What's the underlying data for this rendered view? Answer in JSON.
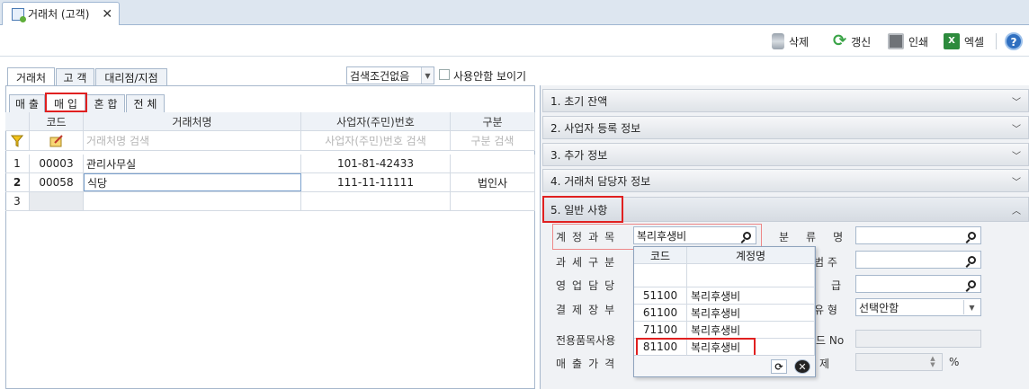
{
  "doc_tab": {
    "title": "거래처 (고객)",
    "close": "✕"
  },
  "toolbar": {
    "delete_label": "삭제",
    "refresh_label": "갱신",
    "print_label": "인쇄",
    "excel_label": "엑셀",
    "help_label": "?"
  },
  "main_tabs": [
    "거래처",
    "고 객",
    "대리점/지점"
  ],
  "search_condition": {
    "value": "검색조건없음",
    "show_unused_label": "사용안함 보이기"
  },
  "sub_tabs": [
    "매 출",
    "매 입",
    "혼 합",
    "전 체"
  ],
  "grid": {
    "columns": [
      "코드",
      "거래처명",
      "사업자(주민)번호",
      "구분"
    ],
    "filter_placeholders": [
      "거래처명 검색",
      "사업자(주민)번호 검색",
      "구분 검색"
    ],
    "rows": [
      {
        "num": "1",
        "code": "00003",
        "name": "관리사무실",
        "bizno": "101-81-42433",
        "type": ""
      },
      {
        "num": "2",
        "code": "00058",
        "name": "식당",
        "bizno": "111-11-11111",
        "type": "법인사"
      },
      {
        "num": "3",
        "code": "",
        "name": "",
        "bizno": "",
        "type": ""
      }
    ]
  },
  "accordion": [
    {
      "label": "1. 초기 잔액",
      "state": "collapsed"
    },
    {
      "label": "2. 사업자 등록 정보",
      "state": "collapsed"
    },
    {
      "label": "3. 추가 정보",
      "state": "collapsed"
    },
    {
      "label": "4. 거래처 담당자 정보",
      "state": "collapsed"
    },
    {
      "label": "5. 일반 사항",
      "state": "expanded"
    }
  ],
  "general_form": {
    "account_label": "계정과목",
    "account_value": "복리후생비",
    "tax_label": "과세구분",
    "sales_rep_label": "영업담당",
    "settle_label": "결제장부",
    "dedicated_label": "전용품목사용",
    "sale_price_label": "매출가격",
    "category_label": "분류명",
    "scope_label_partial": "범 주",
    "grade_label_partial": "급",
    "type_label_partial": "유 형",
    "type_value": "선택안함",
    "code_no_label_partial": "드 No",
    "remove_label_partial": "제",
    "percent_unit": "%"
  },
  "popup": {
    "columns": [
      "코드",
      "계정명"
    ],
    "rows": [
      {
        "code": "51100",
        "name": "복리후생비"
      },
      {
        "code": "61100",
        "name": "복리후생비"
      },
      {
        "code": "71100",
        "name": "복리후생비"
      },
      {
        "code": "81100",
        "name": "복리후생비"
      }
    ]
  },
  "colors": {
    "highlight_box": "#e02020",
    "accordion_bg": "#dfe3e8",
    "panel_border": "#a7b8cc"
  }
}
